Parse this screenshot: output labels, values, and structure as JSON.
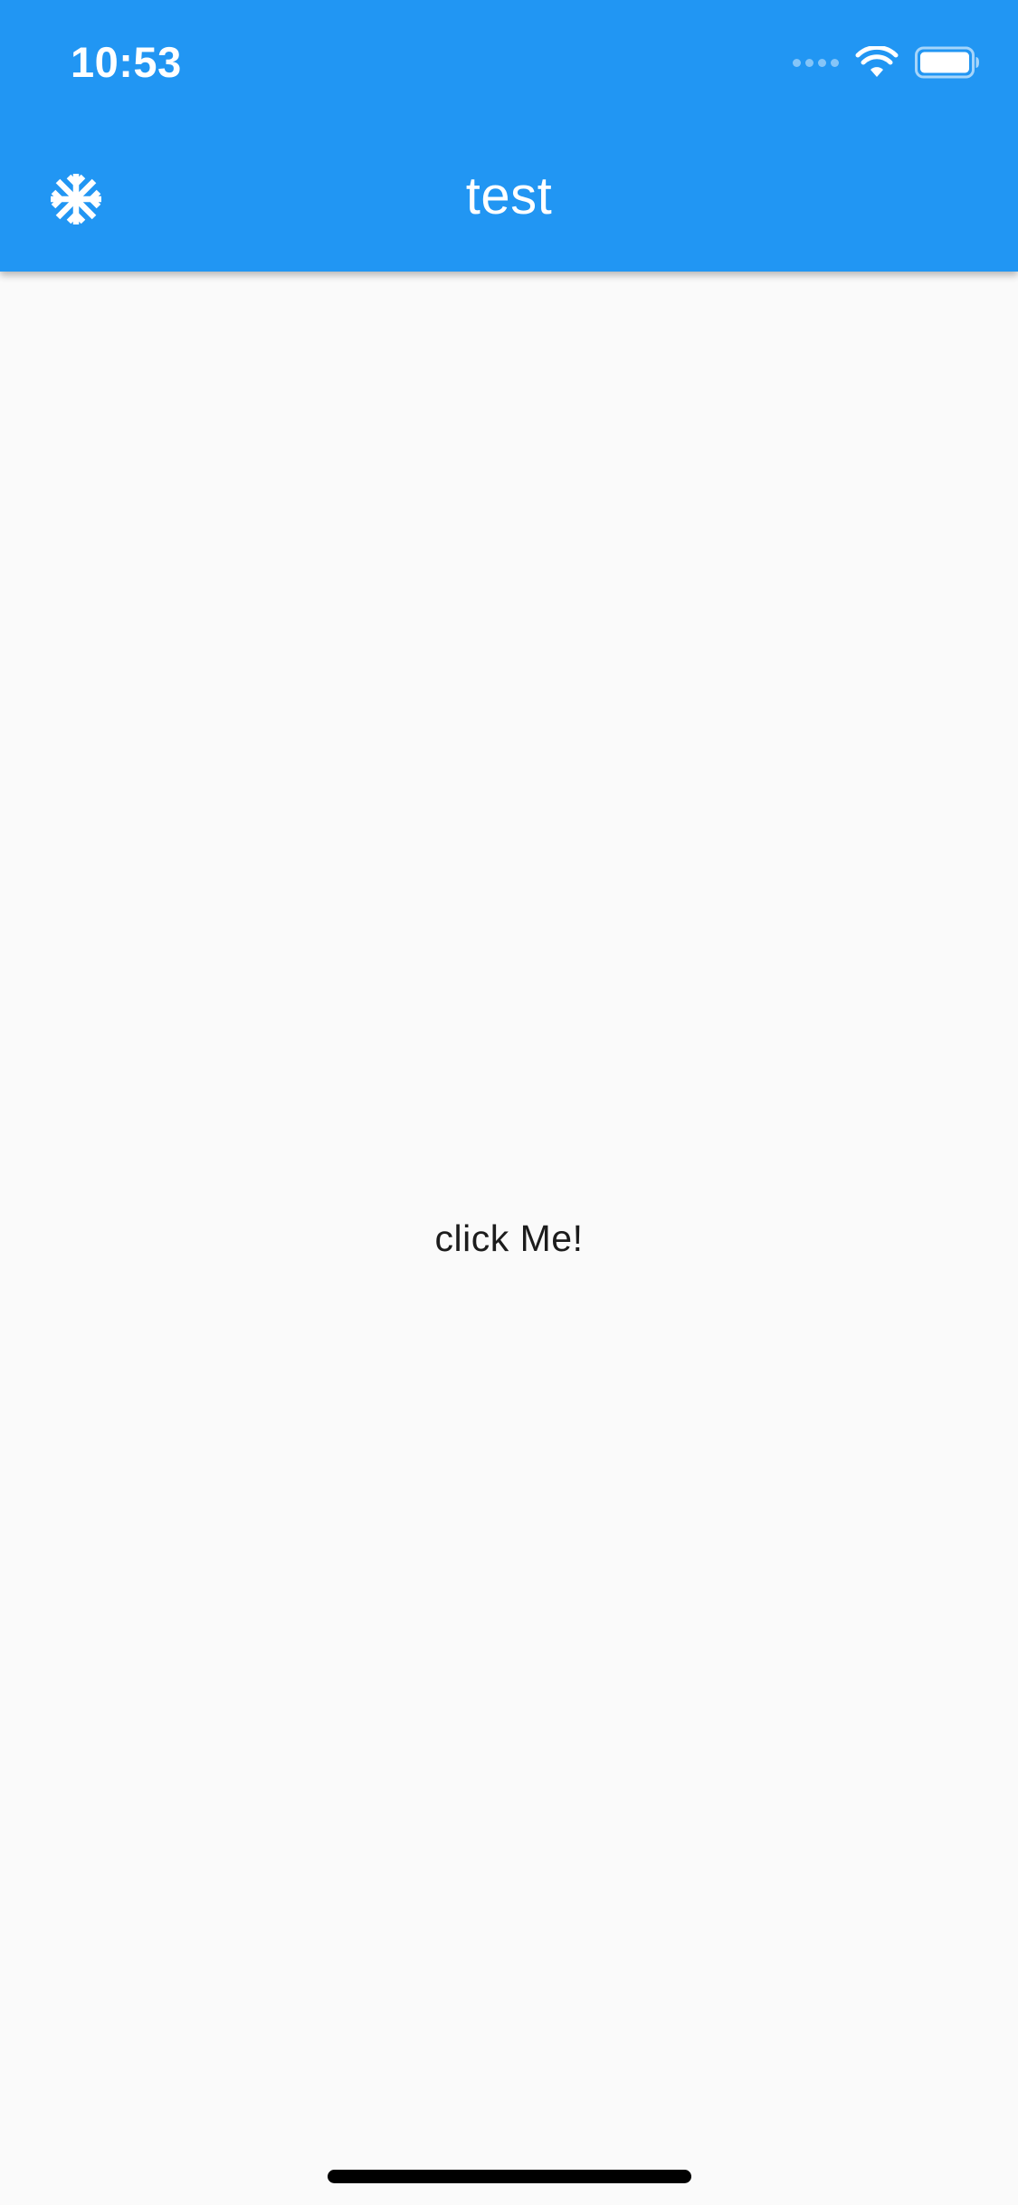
{
  "status_bar": {
    "time": "10:53"
  },
  "app_bar": {
    "title": "test",
    "leading_icon": "snowflake-icon",
    "background_color": "#2196f3"
  },
  "body": {
    "center_text": "click Me!"
  },
  "colors": {
    "app_bar": "#2196f3",
    "background": "#fafafa",
    "text_primary": "#1c1c1c",
    "app_bar_text": "#ffffff"
  }
}
